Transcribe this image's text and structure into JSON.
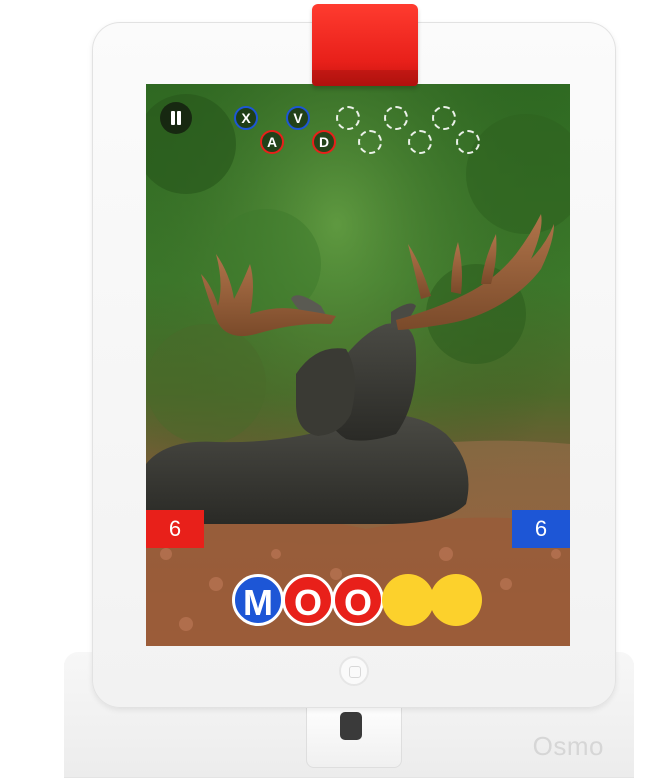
{
  "hud": {
    "pause_icon": "pause-icon",
    "guessed_letters": [
      {
        "letter": "X",
        "team": "blue"
      },
      {
        "letter": "A",
        "team": "red"
      },
      {
        "letter": "V",
        "team": "blue"
      },
      {
        "letter": "D",
        "team": "red"
      }
    ],
    "empty_slots": 6
  },
  "scores": {
    "red": "6",
    "blue": "6"
  },
  "word": {
    "tiles": [
      {
        "letter": "M",
        "color": "blue"
      },
      {
        "letter": "O",
        "color": "red"
      },
      {
        "letter": "O",
        "color": "red"
      },
      {
        "letter": "",
        "color": "yellow"
      },
      {
        "letter": "",
        "color": "yellow"
      }
    ]
  },
  "device": {
    "brand_logo": "Osmo"
  },
  "colors": {
    "team_red": "#e8201a",
    "team_blue": "#1d56d6",
    "empty_tile": "#fcd12c",
    "reflector": "#ff3b2f"
  }
}
